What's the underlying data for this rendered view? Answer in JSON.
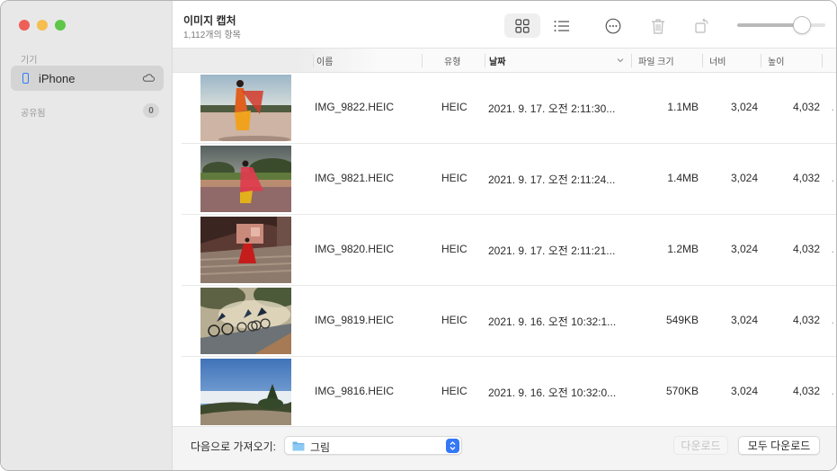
{
  "window": {
    "title": "이미지 캡처",
    "subtitle": "1,112개의 항목"
  },
  "sidebar": {
    "devices_label": "기기",
    "device": {
      "label": "iPhone",
      "icon": "iphone-icon",
      "status_icon": "cloud-icon"
    },
    "shared_label": "공유됨",
    "shared_count": "0"
  },
  "toolbar": {
    "buttons": [
      {
        "name": "grid-view",
        "icon": "grid-icon",
        "active": true
      },
      {
        "name": "list-view",
        "icon": "list-icon",
        "active": false
      },
      {
        "name": "more",
        "icon": "ellipsis-circle-icon",
        "active": false
      },
      {
        "name": "delete",
        "icon": "trash-icon",
        "active": false,
        "disabled": true
      },
      {
        "name": "rotate",
        "icon": "rotate-icon",
        "active": false,
        "disabled": true
      }
    ],
    "thumbnail_size_slider": {
      "value": 0.7
    }
  },
  "columns": {
    "name": "이름",
    "type": "유형",
    "date": "날짜",
    "size": "파일 크기",
    "width": "너비",
    "height": "높이",
    "sorted_by": "date"
  },
  "rows": [
    {
      "name": "IMG_9822.HEIC",
      "type": "HEIC",
      "date": "2021. 9. 17. 오전 2:11:30...",
      "size": "1.1MB",
      "width": "3,024",
      "height": "4,032",
      "thumb": "dancer-red-sari-terrace"
    },
    {
      "name": "IMG_9821.HEIC",
      "type": "HEIC",
      "date": "2021. 9. 17. 오전 2:11:24...",
      "size": "1.4MB",
      "width": "3,024",
      "height": "4,032",
      "thumb": "dancer-red-sari-garden"
    },
    {
      "name": "IMG_9820.HEIC",
      "type": "HEIC",
      "date": "2021. 9. 17. 오전 2:11:21...",
      "size": "1.2MB",
      "width": "3,024",
      "height": "4,032",
      "thumb": "woman-red-dress-stairs"
    },
    {
      "name": "IMG_9819.HEIC",
      "type": "HEIC",
      "date": "2021. 9. 16. 오전 10:32:1...",
      "size": "549KB",
      "width": "3,024",
      "height": "4,032",
      "thumb": "cyclists-road"
    },
    {
      "name": "IMG_9816.HEIC",
      "type": "HEIC",
      "date": "2021. 9. 16. 오전 10:32:0...",
      "size": "570KB",
      "width": "3,024",
      "height": "4,032",
      "thumb": "mountain-above-clouds"
    }
  ],
  "footer": {
    "import_label": "다음으로 가져오기:",
    "import_destination": "그림",
    "download_label": "다운로드",
    "download_all_label": "모두 다운로드"
  },
  "colors": {
    "accent": "#3478f6",
    "close": "#ee5f57",
    "minimize": "#f5be4f",
    "maximize": "#5ec648"
  }
}
